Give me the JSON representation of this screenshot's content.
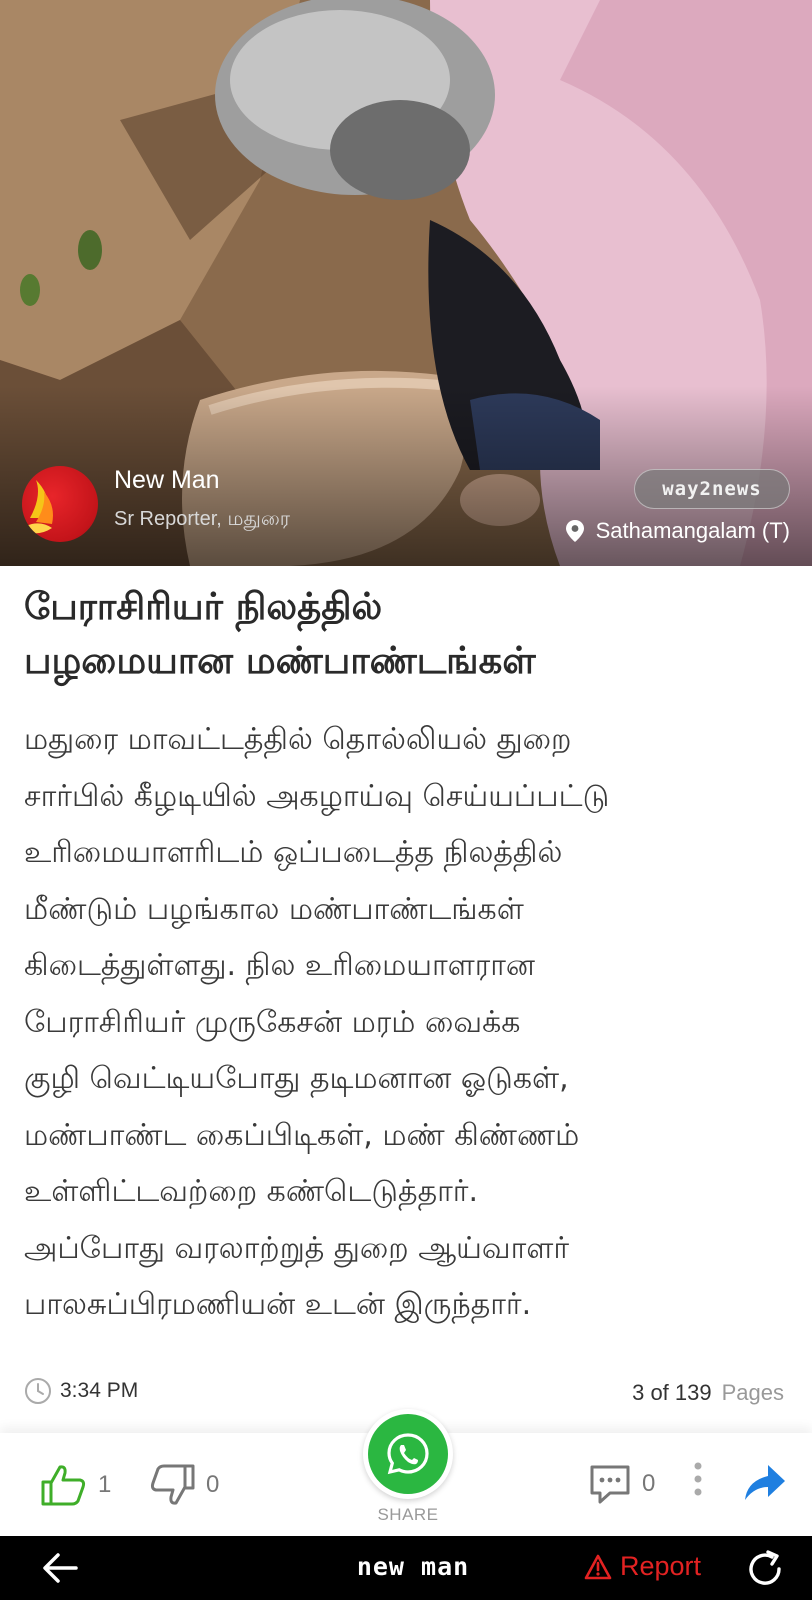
{
  "author": {
    "name": "New Man",
    "role": "Sr Reporter, மதுரை"
  },
  "brand_badge": "way2news",
  "location": "Sathamangalam (T)",
  "article": {
    "headline_lines": [
      "பேராசிரியர் நிலத்தில்",
      "பழமையான மண்பாண்டங்கள்"
    ],
    "body_lines": [
      "மதுரை மாவட்டத்தில் தொல்லியல் துறை",
      "சார்பில் கீழடியில் அகழாய்வு செய்யப்பட்டு",
      "உரிமையாளரிடம் ஒப்படைத்த நிலத்தில்",
      "மீண்டும் பழங்கால மண்பாண்டங்கள்",
      "கிடைத்துள்ளது. நில உரிமையாளரான",
      "பேராசிரியர் முருகேசன் மரம் வைக்க",
      "குழி வெட்டியபோது தடிமனான ஓடுகள்,",
      "மண்பாண்ட கைப்பிடிகள், மண் கிண்ணம்",
      "உள்ளிட்டவற்றை கண்டெடுத்தார்.",
      "அப்போது வரலாற்றுத் துறை ஆய்வாளர்",
      "பாலசுப்பிரமணியன் உடன் இருந்தார்."
    ]
  },
  "meta": {
    "time": "3:34 PM",
    "page_position": "3 of 139",
    "pages_label": "Pages"
  },
  "actions": {
    "likes": "1",
    "dislikes": "0",
    "share_label": "SHARE",
    "comments": "0"
  },
  "nav": {
    "brand": "new man",
    "report_label": "Report"
  },
  "colors": {
    "like_green": "#3fae29",
    "whatsapp_green": "#2bb741",
    "forward_blue": "#1f7fe0",
    "report_red": "#e32222"
  },
  "icons": [
    "clock-icon",
    "thumbs-up-icon",
    "thumbs-down-icon",
    "whatsapp-icon",
    "comment-icon",
    "more-vertical-icon",
    "forward-arrow-icon",
    "back-arrow-icon",
    "warning-icon",
    "refresh-icon",
    "location-pin-icon"
  ]
}
